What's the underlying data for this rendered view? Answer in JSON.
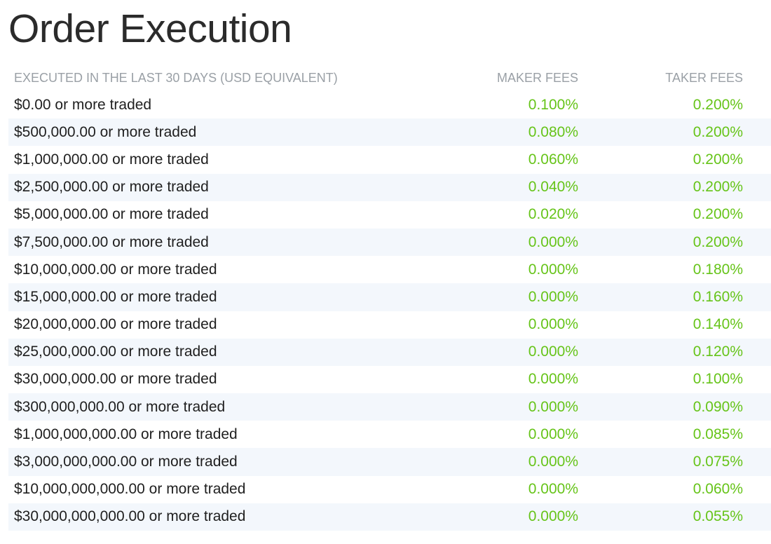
{
  "page": {
    "title": "Order Execution"
  },
  "colors": {
    "fee_text": "#66c419",
    "header_text": "#9aa0a6",
    "row_stripe": "#f3f7fc"
  },
  "table": {
    "headers": {
      "volume": "EXECUTED IN THE LAST 30 DAYS (USD EQUIVALENT)",
      "maker": "MAKER FEES",
      "taker": "TAKER FEES"
    },
    "rows": [
      {
        "volume": "$0.00 or more traded",
        "maker": "0.100%",
        "taker": "0.200%"
      },
      {
        "volume": "$500,000.00 or more traded",
        "maker": "0.080%",
        "taker": "0.200%"
      },
      {
        "volume": "$1,000,000.00 or more traded",
        "maker": "0.060%",
        "taker": "0.200%"
      },
      {
        "volume": "$2,500,000.00 or more traded",
        "maker": "0.040%",
        "taker": "0.200%"
      },
      {
        "volume": "$5,000,000.00 or more traded",
        "maker": "0.020%",
        "taker": "0.200%"
      },
      {
        "volume": "$7,500,000.00 or more traded",
        "maker": "0.000%",
        "taker": "0.200%"
      },
      {
        "volume": "$10,000,000.00 or more traded",
        "maker": "0.000%",
        "taker": "0.180%"
      },
      {
        "volume": "$15,000,000.00 or more traded",
        "maker": "0.000%",
        "taker": "0.160%"
      },
      {
        "volume": "$20,000,000.00 or more traded",
        "maker": "0.000%",
        "taker": "0.140%"
      },
      {
        "volume": "$25,000,000.00 or more traded",
        "maker": "0.000%",
        "taker": "0.120%"
      },
      {
        "volume": "$30,000,000.00 or more traded",
        "maker": "0.000%",
        "taker": "0.100%"
      },
      {
        "volume": "$300,000,000.00 or more traded",
        "maker": "0.000%",
        "taker": "0.090%"
      },
      {
        "volume": "$1,000,000,000.00 or more traded",
        "maker": "0.000%",
        "taker": "0.085%"
      },
      {
        "volume": "$3,000,000,000.00 or more traded",
        "maker": "0.000%",
        "taker": "0.075%"
      },
      {
        "volume": "$10,000,000,000.00 or more traded",
        "maker": "0.000%",
        "taker": "0.060%"
      },
      {
        "volume": "$30,000,000,000.00 or more traded",
        "maker": "0.000%",
        "taker": "0.055%"
      }
    ]
  }
}
